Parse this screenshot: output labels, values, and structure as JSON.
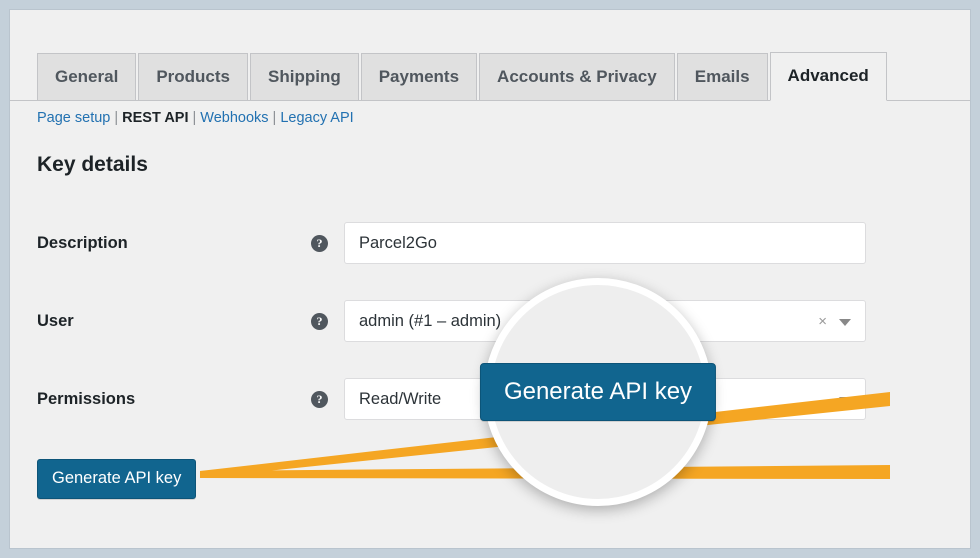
{
  "tabs": [
    {
      "label": "General",
      "active": false
    },
    {
      "label": "Products",
      "active": false
    },
    {
      "label": "Shipping",
      "active": false
    },
    {
      "label": "Payments",
      "active": false
    },
    {
      "label": "Accounts & Privacy",
      "active": false
    },
    {
      "label": "Emails",
      "active": false
    },
    {
      "label": "Advanced",
      "active": true
    }
  ],
  "subnav": {
    "items": [
      {
        "label": "Page setup",
        "current": false
      },
      {
        "label": "REST API",
        "current": true
      },
      {
        "label": "Webhooks",
        "current": false
      },
      {
        "label": "Legacy API",
        "current": false
      }
    ],
    "separator": "|"
  },
  "heading": "Key details",
  "form": {
    "rows": [
      {
        "label": "Description",
        "help_icon": "help-question-icon",
        "help_glyph": "?",
        "value": "Parcel2Go",
        "has_clear": false,
        "has_caret": false
      },
      {
        "label": "User",
        "help_icon": "help-question-icon",
        "help_glyph": "?",
        "value": "admin (#1 – admin)",
        "has_clear": true,
        "clear_glyph": "×",
        "has_caret": true
      },
      {
        "label": "Permissions",
        "help_icon": "help-question-icon",
        "help_glyph": "?",
        "value": "Read/Write",
        "has_clear": false,
        "has_caret": true
      }
    ]
  },
  "submit_button": {
    "label": "Generate API key"
  },
  "magnifier": {
    "button_label": "Generate API key"
  },
  "colors": {
    "page_background": "#f0f0f0",
    "outer_frame": "#c4d0da",
    "button_blue": "#11658f",
    "link_blue": "#2271b1",
    "callout_orange": "#f5a623",
    "tab_inactive": "#e0e0e0",
    "tab_active": "#f0f0f0",
    "help_icon_gray": "#50575e"
  }
}
